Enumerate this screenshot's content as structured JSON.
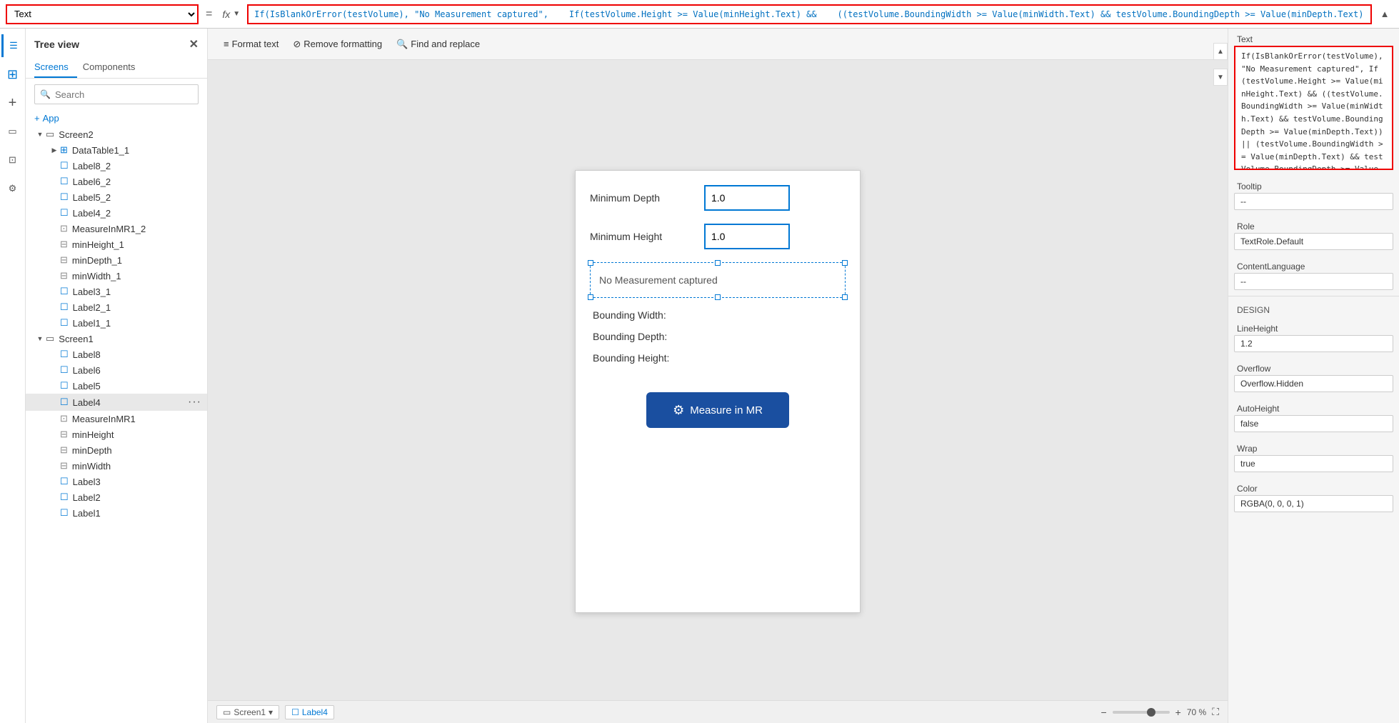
{
  "formulaBar": {
    "selectValue": "Text",
    "equals": "=",
    "fx": "fx",
    "formula": "If(IsBlankOrError(testVolume), \"No Measurement captured\",\n    If(testVolume.Height >= Value(minHeight.Text) &&\n    ((testVolume.BoundingWidth >= Value(minWidth.Text) && testVolume.BoundingDepth >= Value(minDepth.Text)) ||\n    (testVolume.BoundingWidth >= Value(minDepth.Text) && testVolume.BoundingDepth >= Value(minWidth.Text))),\n    \"Fit Test Succeeded\", \"Fit Test Failed\"))"
  },
  "treeView": {
    "title": "Tree view",
    "closeIcon": "✕",
    "tabs": [
      {
        "label": "Screens",
        "active": true
      },
      {
        "label": "Components",
        "active": false
      }
    ],
    "searchPlaceholder": "Search",
    "addIcon": "+",
    "addLabel": "App",
    "items": [
      {
        "id": "screen2",
        "label": "Screen2",
        "level": 0,
        "type": "screen",
        "expanded": true,
        "expander": "▼"
      },
      {
        "id": "datatable1_1",
        "label": "DataTable1_1",
        "level": 1,
        "type": "table",
        "expander": "▶"
      },
      {
        "id": "label8_2",
        "label": "Label8_2",
        "level": 1,
        "type": "label",
        "expander": ""
      },
      {
        "id": "label6_2",
        "label": "Label6_2",
        "level": 1,
        "type": "label",
        "expander": ""
      },
      {
        "id": "label5_2",
        "label": "Label5_2",
        "level": 1,
        "type": "label",
        "expander": ""
      },
      {
        "id": "label4_2",
        "label": "Label4_2",
        "level": 1,
        "type": "label",
        "expander": ""
      },
      {
        "id": "measureinmr1_2",
        "label": "MeasureInMR1_2",
        "level": 1,
        "type": "input",
        "expander": ""
      },
      {
        "id": "minheight_1",
        "label": "minHeight_1",
        "level": 1,
        "type": "input2",
        "expander": ""
      },
      {
        "id": "mindepth_1",
        "label": "minDepth_1",
        "level": 1,
        "type": "input2",
        "expander": ""
      },
      {
        "id": "minwidth_1",
        "label": "minWidth_1",
        "level": 1,
        "type": "input2",
        "expander": ""
      },
      {
        "id": "label3_1",
        "label": "Label3_1",
        "level": 1,
        "type": "label",
        "expander": ""
      },
      {
        "id": "label2_1",
        "label": "Label2_1",
        "level": 1,
        "type": "label",
        "expander": ""
      },
      {
        "id": "label1_1",
        "label": "Label1_1",
        "level": 1,
        "type": "label",
        "expander": ""
      },
      {
        "id": "screen1",
        "label": "Screen1",
        "level": 0,
        "type": "screen",
        "expanded": true,
        "expander": "▼"
      },
      {
        "id": "label8",
        "label": "Label8",
        "level": 1,
        "type": "label",
        "expander": ""
      },
      {
        "id": "label6",
        "label": "Label6",
        "level": 1,
        "type": "label",
        "expander": ""
      },
      {
        "id": "label5",
        "label": "Label5",
        "level": 1,
        "type": "label",
        "expander": ""
      },
      {
        "id": "label4",
        "label": "Label4",
        "level": 1,
        "type": "label",
        "expander": "",
        "selected": true
      },
      {
        "id": "measureinmr1",
        "label": "MeasureInMR1",
        "level": 1,
        "type": "input",
        "expander": ""
      },
      {
        "id": "minheight",
        "label": "minHeight",
        "level": 1,
        "type": "input2",
        "expander": ""
      },
      {
        "id": "mindepth",
        "label": "minDepth",
        "level": 1,
        "type": "input2",
        "expander": ""
      },
      {
        "id": "minwidth",
        "label": "minWidth",
        "level": 1,
        "type": "input2",
        "expander": ""
      },
      {
        "id": "label3",
        "label": "Label3",
        "level": 1,
        "type": "label",
        "expander": ""
      },
      {
        "id": "label2",
        "label": "Label2",
        "level": 1,
        "type": "label",
        "expander": ""
      },
      {
        "id": "label1",
        "label": "Label1",
        "level": 1,
        "type": "label",
        "expander": ""
      }
    ]
  },
  "toolbar": {
    "formatText": "Format text",
    "removeFormatting": "Remove formatting",
    "findAndReplace": "Find and replace"
  },
  "canvas": {
    "formRows": [
      {
        "label": "Minimum Depth",
        "value": "1.0"
      },
      {
        "label": "Minimum Height",
        "value": "1.0"
      }
    ],
    "labelText": "No Measurement captured",
    "boundingLabels": [
      "Bounding Width:",
      "Bounding Depth:",
      "Bounding Height:"
    ],
    "measureBtn": "Measure in MR"
  },
  "propertiesPanel": {
    "textLabel": "Text",
    "textContent": "If(IsBlankOrError(testVolume), \"No Measurement captured\", If(testVolume.Height >= Value(minHeight.Text) && ((testVolume.BoundingWidth >= Value(minWidth.Text) && testVolume.BoundingDepth >= Value(minDepth.Text)) || (testVolume.BoundingWidth >= Value(minDepth.Text) && testVolume.BoundingDepth >= Value(minWidth.Text))), \"Fit Test Succeeded\", \"Fit Test Failed\"))",
    "tooltipLabel": "Tooltip",
    "tooltipValue": "--",
    "roleLabel": "Role",
    "roleValue": "TextRole.Default",
    "contentLanguageLabel": "ContentLanguage",
    "contentLanguageValue": "--",
    "designLabel": "DESIGN",
    "lineHeightLabel": "LineHeight",
    "lineHeightValue": "1.2",
    "overflowLabel": "Overflow",
    "overflowValue": "Overflow.Hidden",
    "autoHeightLabel": "AutoHeight",
    "autoHeightValue": "false",
    "wrapLabel": "Wrap",
    "wrapValue": "true",
    "colorLabel": "Color",
    "colorValue": "RGBA(0, 0, 0, 1)"
  },
  "statusBar": {
    "screen": "Screen1",
    "label": "Label4",
    "zoomMinus": "−",
    "zoomPlus": "+",
    "zoomValue": "70 %"
  },
  "sidebarIcons": [
    {
      "name": "layers-icon",
      "symbol": "≡",
      "active": false
    },
    {
      "name": "tree-icon",
      "symbol": "⊞",
      "active": true
    },
    {
      "name": "plus-icon",
      "symbol": "+",
      "active": false
    },
    {
      "name": "mobile-icon",
      "symbol": "▭",
      "active": false
    },
    {
      "name": "component-icon",
      "symbol": "⊡",
      "active": false
    },
    {
      "name": "settings-icon",
      "symbol": "⚙",
      "active": false
    }
  ]
}
